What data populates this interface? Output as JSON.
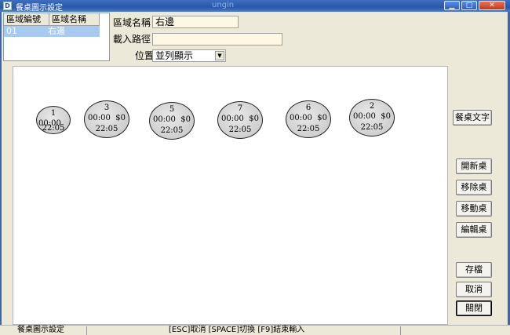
{
  "window": {
    "title": "餐桌圖示設定",
    "title_faint": "ungin",
    "minimize": "▁",
    "maximize": "□",
    "close": "✕"
  },
  "zone_table": {
    "headers": [
      "區域編號",
      "區域名稱"
    ],
    "rows": [
      {
        "code": "01",
        "name": "右邊"
      }
    ]
  },
  "form": {
    "name_label": "區域名稱",
    "name_value": "右邊",
    "path_label": "載入路徑",
    "path_value": "",
    "position_label": "位置",
    "position_value": "並列顯示"
  },
  "tables": [
    {
      "number": "1",
      "time": "00:00",
      "amount": "",
      "clock": "22:05"
    },
    {
      "number": "3",
      "time": "00:00",
      "amount": "$0",
      "clock": "22:05"
    },
    {
      "number": "5",
      "time": "00:00",
      "amount": "$0",
      "clock": "22:05"
    },
    {
      "number": "7",
      "time": "00:00",
      "amount": "$0",
      "clock": "22:05"
    },
    {
      "number": "6",
      "time": "00:00",
      "amount": "$0",
      "clock": "22:05"
    },
    {
      "number": "2",
      "time": "00:00",
      "amount": "$0",
      "clock": "22:05"
    }
  ],
  "buttons": {
    "label_text": "餐桌文字",
    "new_table": "開新桌",
    "remove_table": "移除桌",
    "move_table": "移動桌",
    "edit_table": "編輯桌",
    "save": "存檔",
    "cancel": "取消",
    "close": "關閉"
  },
  "statusbar": {
    "left": "餐桌圖示設定",
    "hint": "[ESC]取消 [SPACE]切換 [F9]結束輸入"
  }
}
